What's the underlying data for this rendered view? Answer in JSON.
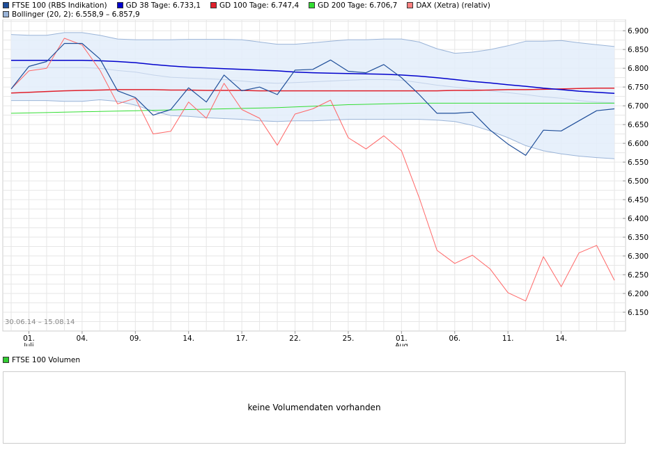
{
  "legend_main": [
    {
      "label": "FTSE 100 (RBS Indikation)",
      "color": "#1f4e99"
    },
    {
      "label": "GD 38 Tage: 6.733,1",
      "color": "#0000cc"
    },
    {
      "label": "GD 100 Tage: 6.747,4",
      "color": "#e0202b"
    },
    {
      "label": "GD 200 Tage: 6.706,7",
      "color": "#33dd33"
    },
    {
      "label": "DAX (Xetra) (relativ)",
      "color": "#ff8080"
    }
  ],
  "legend_bollinger": {
    "label": "Bollinger (20, 2): 6.558,9 – 6.857,9",
    "color": "#9ab4d8"
  },
  "legend_volume": {
    "label": "FTSE 100 Volumen",
    "color": "#33cc33"
  },
  "volume_message": "keine Volumendaten vorhanden",
  "chart_data": {
    "type": "line",
    "date_range": "30.06.14 – 15.08.14",
    "x_tick_labels": [
      "01.",
      "04.",
      "09.",
      "14.",
      "17.",
      "22.",
      "25.",
      "01.",
      "06.",
      "11.",
      "14."
    ],
    "x_month_labels": [
      "Juli",
      "Aug"
    ],
    "x_tick_points": [
      1,
      4,
      7,
      10,
      13,
      16,
      19,
      22,
      25,
      28,
      31
    ],
    "y_ticks": [
      6150,
      6200,
      6250,
      6300,
      6350,
      6400,
      6450,
      6500,
      6550,
      6600,
      6650,
      6700,
      6750,
      6800,
      6850,
      6900
    ],
    "y_tick_labels": [
      "6.150",
      "6.200",
      "6.250",
      "6.300",
      "6.350",
      "6.400",
      "6.450",
      "6.500",
      "6.550",
      "6.600",
      "6.650",
      "6.700",
      "6.750",
      "6.800",
      "6.850",
      "6.900"
    ],
    "ylim": [
      6100,
      6930
    ],
    "grid": true,
    "series": [
      {
        "name": "FTSE 100 (RBS Indikation)",
        "color": "#1f4e99",
        "values": [
          6745,
          6805,
          6818,
          6866,
          6866,
          6825,
          6740,
          6722,
          6675,
          6690,
          6748,
          6710,
          6782,
          6740,
          6750,
          6730,
          6795,
          6797,
          6822,
          6792,
          6788,
          6810,
          6775,
          6730,
          6680,
          6680,
          6683,
          6635,
          6598,
          6568,
          6635,
          6633,
          6660,
          6687,
          6692
        ]
      },
      {
        "name": "GD 38 Tage: 6.733,1",
        "color": "#0000cc",
        "values": [
          6821,
          6821,
          6821,
          6821,
          6821,
          6820,
          6818,
          6815,
          6810,
          6806,
          6803,
          6801,
          6799,
          6797,
          6795,
          6793,
          6790,
          6788,
          6787,
          6786,
          6785,
          6784,
          6782,
          6779,
          6775,
          6770,
          6765,
          6761,
          6756,
          6752,
          6747,
          6743,
          6739,
          6736,
          6733
        ]
      },
      {
        "name": "GD 100 Tage: 6.747,4",
        "color": "#e0202b",
        "values": [
          6734,
          6736,
          6738,
          6740,
          6741,
          6742,
          6743,
          6743,
          6743,
          6742,
          6742,
          6741,
          6741,
          6741,
          6740,
          6740,
          6740,
          6740,
          6740,
          6740,
          6740,
          6740,
          6740,
          6740,
          6740,
          6741,
          6741,
          6742,
          6743,
          6743,
          6744,
          6745,
          6746,
          6747,
          6747
        ]
      },
      {
        "name": "GD 200 Tage: 6.706,7",
        "color": "#33dd33",
        "values": [
          6680,
          6681,
          6682,
          6683,
          6684,
          6685,
          6686,
          6687,
          6688,
          6689,
          6690,
          6691,
          6692,
          6693,
          6694,
          6695,
          6697,
          6699,
          6701,
          6703,
          6704,
          6705,
          6706,
          6707,
          6707,
          6707,
          6707,
          6707,
          6707,
          6707,
          6707,
          6707,
          6707,
          6707,
          6707
        ]
      },
      {
        "name": "DAX (Xetra) (relativ)",
        "color": "#ff6666",
        "values": [
          6745,
          6793,
          6800,
          6880,
          6862,
          6795,
          6705,
          6720,
          6625,
          6632,
          6710,
          6667,
          6760,
          6690,
          6667,
          6595,
          6678,
          6692,
          6715,
          6615,
          6585,
          6620,
          6580,
          6455,
          6315,
          6280,
          6302,
          6265,
          6202,
          6180,
          6298,
          6218,
          6308,
          6328,
          6235
        ]
      }
    ],
    "bollinger": {
      "name": "Bollinger (20, 2): 6.558,9 – 6.857,9",
      "upper": [
        6890,
        6888,
        6888,
        6895,
        6895,
        6888,
        6878,
        6876,
        6876,
        6876,
        6877,
        6877,
        6877,
        6876,
        6870,
        6864,
        6864,
        6868,
        6872,
        6876,
        6876,
        6878,
        6878,
        6870,
        6852,
        6840,
        6843,
        6850,
        6860,
        6872,
        6872,
        6874,
        6868,
        6863,
        6858
      ],
      "middle": [
        6802,
        6802,
        6802,
        6802,
        6802,
        6800,
        6794,
        6790,
        6782,
        6776,
        6774,
        6772,
        6770,
        6766,
        6762,
        6760,
        6762,
        6764,
        6766,
        6768,
        6770,
        6770,
        6768,
        6762,
        6755,
        6750,
        6745,
        6740,
        6735,
        6730,
        6724,
        6720,
        6714,
        6710,
        6708
      ],
      "lower": [
        6714,
        6714,
        6714,
        6712,
        6712,
        6716,
        6712,
        6702,
        6686,
        6674,
        6672,
        6668,
        6666,
        6664,
        6660,
        6658,
        6660,
        6660,
        6662,
        6664,
        6664,
        6664,
        6664,
        6664,
        6662,
        6658,
        6648,
        6633,
        6615,
        6594,
        6580,
        6572,
        6566,
        6562,
        6559
      ],
      "fill_color": "#e3edfa",
      "line_color": "#9ab4d8"
    }
  }
}
